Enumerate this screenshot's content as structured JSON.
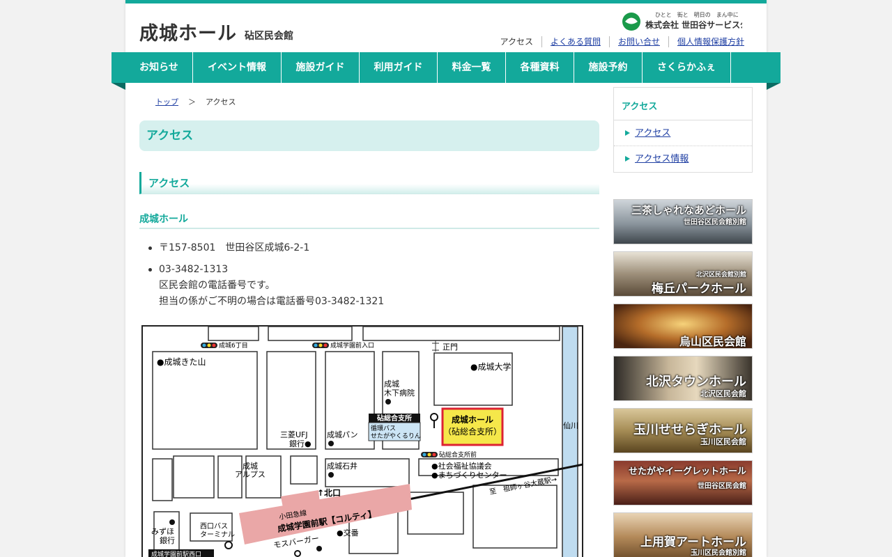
{
  "header": {
    "site_title": "成城ホール",
    "site_subtitle": "砧区民会館",
    "logo_text": "株式会社 世田谷サービス公社",
    "logo_tagline": "ひとと　街と　明日の　まん中に"
  },
  "utility": {
    "current": "アクセス",
    "faq": "よくある質問",
    "contact": "お問い合せ",
    "privacy": "個人情報保護方針"
  },
  "gnav": [
    {
      "label": "お知らせ"
    },
    {
      "label": "イベント情報"
    },
    {
      "label": "施設ガイド"
    },
    {
      "label": "利用ガイド"
    },
    {
      "label": "料金一覧"
    },
    {
      "label": "各種資料"
    },
    {
      "label": "施設予約"
    },
    {
      "label": "さくらかふぇ"
    }
  ],
  "breadcrumb": {
    "home": "トップ",
    "sep": "＞",
    "current": "アクセス"
  },
  "main": {
    "h1": "アクセス",
    "h2": "アクセス",
    "h3": "成城ホール",
    "address": "〒157-8501　世田谷区成城6-2-1",
    "phone": "03-3482-1313",
    "phone_note1": "区民会館の電話番号です。",
    "phone_note2": "担当の係がご不明の場合は電話番号03-3482-1321"
  },
  "map": {
    "signal1": "成城6丁目",
    "signal2": "成城学園前入口",
    "signal3": "砧総合支所前",
    "kitayama": "●成城きた山",
    "seimon": "正門",
    "univ": "●成城大学",
    "hospital1": "成城",
    "hospital2": "木下病院",
    "branch": "砧総合支所",
    "bus1": "循環バス",
    "bus2": "せたがやくるりん",
    "hall1": "成城ホール",
    "hall2": "（砧総合支所）",
    "river": "仙川",
    "ufj1": "三菱UFJ",
    "ufj2": "銀行●",
    "bread": "成城パン",
    "alps1": "成城",
    "alps2": "アルプス",
    "ishii": "成城石井",
    "welfare": "●社会福祉協議会",
    "machi": "●まちづくりセンター",
    "soshigaya": "至　祖師ヶ谷大蔵駅→",
    "kitaguchi": "↑北口",
    "odakyu": "小田急線",
    "station": "成城学園前駅【コルティ】",
    "koban": "●交番",
    "mizuho1": "みずほ",
    "mizuho2": "銀行",
    "busterm1": "西口バス",
    "busterm2": "ターミナル",
    "mos": "モスバーガー",
    "westexit": "成城学園前駅西口"
  },
  "sidebar": {
    "heading": "アクセス",
    "items": [
      {
        "label": "アクセス"
      },
      {
        "label": "アクセス情報"
      }
    ]
  },
  "banners": [
    {
      "title": "三茶しゃれなあどホール",
      "sub": "世田谷区民会館別館"
    },
    {
      "title": "梅丘パークホール",
      "sub": "北沢区民会館別館"
    },
    {
      "title": "烏山区民会館",
      "sub": ""
    },
    {
      "title": "北沢タウンホール",
      "sub": "北沢区民会館"
    },
    {
      "title": "玉川せせらぎホール",
      "sub": "玉川区民会館"
    },
    {
      "title": "せたがやイーグレットホール",
      "sub": "世田谷区民会館"
    },
    {
      "title": "上用賀アートホール",
      "sub": "玉川区民会館別館"
    }
  ],
  "colors": {
    "accent": "#13a99b",
    "link": "#1f3fa3",
    "station_pink": "#eaa7a7",
    "hall_yellow": "#f5e74a",
    "river_blue": "#bfdcf0"
  }
}
